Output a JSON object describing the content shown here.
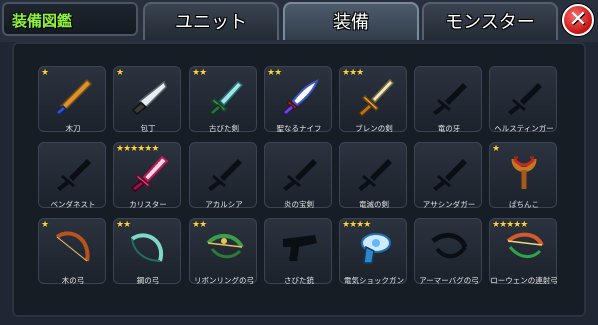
{
  "header": {
    "title": "装備図鑑",
    "tabs": [
      {
        "label": "ユニット",
        "active": false
      },
      {
        "label": "装備",
        "active": true
      },
      {
        "label": "モンスター",
        "active": false
      }
    ],
    "close_icon": "close-icon"
  },
  "colors": {
    "title": "#8ff23a",
    "star": "#ffd23a",
    "close": "#d11b1b",
    "silhouette": "#0b0e12"
  },
  "items": [
    {
      "label": "木刀",
      "stars": "★",
      "icon": "wooden-sword-icon",
      "unlocked": true
    },
    {
      "label": "包丁",
      "stars": "★",
      "icon": "kitchen-knife-icon",
      "unlocked": true
    },
    {
      "label": "古びた剣",
      "stars": "★★",
      "icon": "old-sword-icon",
      "unlocked": true
    },
    {
      "label": "聖なるナイフ",
      "stars": "★★",
      "icon": "holy-knife-icon",
      "unlocked": true
    },
    {
      "label": "ブレンの剣",
      "stars": "★★★",
      "icon": "bren-sword-icon",
      "unlocked": true
    },
    {
      "label": "竜の牙",
      "stars": "",
      "icon": "locked-sword-icon",
      "unlocked": false
    },
    {
      "label": "ヘルスティンガー",
      "stars": "",
      "icon": "locked-sword-icon",
      "unlocked": false
    },
    {
      "label": "ベンダネスト",
      "stars": "",
      "icon": "locked-sword-icon",
      "unlocked": false
    },
    {
      "label": "カリスター",
      "stars": "★★★★★★",
      "icon": "calister-sword-icon",
      "unlocked": true
    },
    {
      "label": "アカルシア",
      "stars": "",
      "icon": "locked-sword-icon",
      "unlocked": false
    },
    {
      "label": "炎の宝剣",
      "stars": "",
      "icon": "locked-sword-icon",
      "unlocked": false
    },
    {
      "label": "竜滅の剣",
      "stars": "",
      "icon": "locked-sword-icon",
      "unlocked": false
    },
    {
      "label": "アサシンダガー",
      "stars": "",
      "icon": "locked-sword-icon",
      "unlocked": false
    },
    {
      "label": "ぱちんこ",
      "stars": "★",
      "icon": "slingshot-icon",
      "unlocked": true
    },
    {
      "label": "木の弓",
      "stars": "★",
      "icon": "wooden-bow-icon",
      "unlocked": true
    },
    {
      "label": "鋼の弓",
      "stars": "★★",
      "icon": "steel-bow-icon",
      "unlocked": true
    },
    {
      "label": "リボンリングの弓",
      "stars": "★★",
      "icon": "ribbon-bow-icon",
      "unlocked": true
    },
    {
      "label": "さびた銃",
      "stars": "",
      "icon": "locked-gun-icon",
      "unlocked": false
    },
    {
      "label": "電気ショックガン",
      "stars": "★★★★",
      "icon": "shock-gun-icon",
      "unlocked": true
    },
    {
      "label": "アーマーバグの弓",
      "stars": "",
      "icon": "locked-bow-icon",
      "unlocked": false
    },
    {
      "label": "ローウェンの連射弓",
      "stars": "★★★★★",
      "icon": "rowen-bow-icon",
      "unlocked": true
    }
  ]
}
